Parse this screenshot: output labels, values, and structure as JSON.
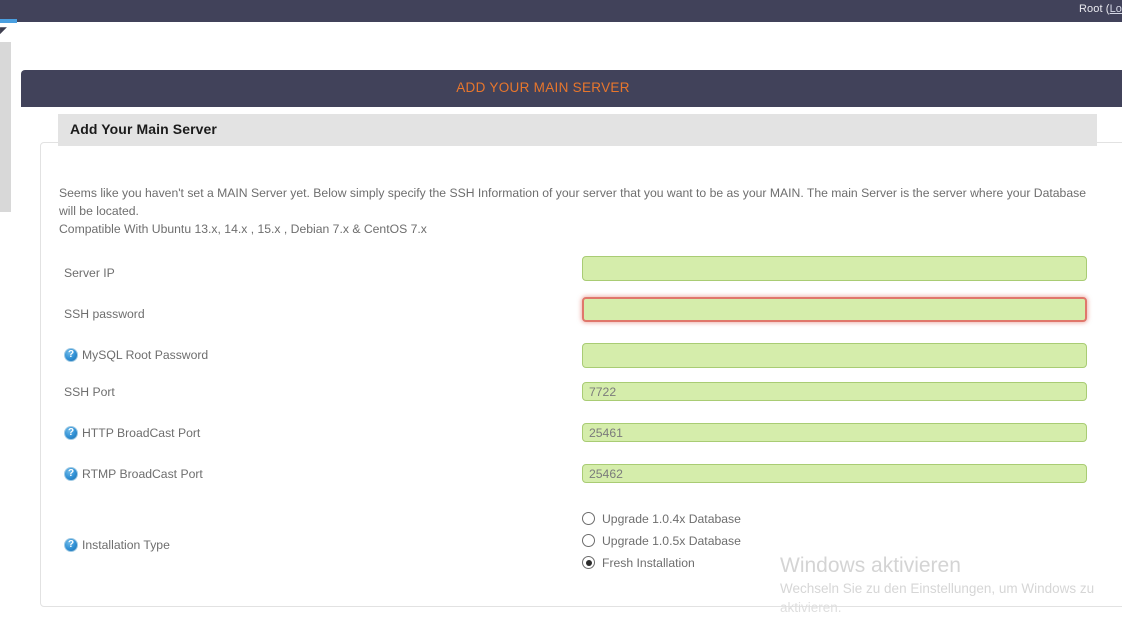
{
  "topbar": {
    "user_prefix": "Root (",
    "user_link": "Lo"
  },
  "left_gutter": {
    "glyph": "◤"
  },
  "banner": {
    "title": "ADD YOUR MAIN SERVER"
  },
  "section": {
    "heading": "Add Your Main Server"
  },
  "intro": {
    "paragraph": "Seems like you haven't set a MAIN Server yet. Below simply specify the SSH Information of your server that you want to be as your MAIN. The main Server is the server where your Database will be located.",
    "compatible": "Compatible With Ubuntu 13.x, 14.x , 15.x , Debian 7.x & CentOS 7.x"
  },
  "form": {
    "fields": [
      {
        "label": "Server IP",
        "value": "",
        "placeholder": "",
        "has_help_icon": false,
        "size": "tall",
        "state": "normal"
      },
      {
        "label": "SSH password",
        "value": "",
        "placeholder": "",
        "has_help_icon": false,
        "size": "tall",
        "state": "error"
      },
      {
        "label": "MySQL Root Password",
        "value": "",
        "placeholder": "",
        "has_help_icon": true,
        "size": "tall",
        "state": "normal"
      },
      {
        "label": "SSH Port",
        "value": "7722",
        "placeholder": "",
        "has_help_icon": false,
        "size": "short",
        "state": "normal"
      },
      {
        "label": "HTTP BroadCast Port",
        "value": "25461",
        "placeholder": "",
        "has_help_icon": true,
        "size": "short",
        "state": "normal"
      },
      {
        "label": "RTMP BroadCast Port",
        "value": "25462",
        "placeholder": "",
        "has_help_icon": true,
        "size": "short",
        "state": "normal"
      }
    ],
    "installation_type": {
      "label": "Installation Type",
      "has_help_icon": true,
      "options": [
        {
          "label": "Upgrade 1.0.4x Database",
          "selected": false
        },
        {
          "label": "Upgrade 1.0.5x Database",
          "selected": false
        },
        {
          "label": "Fresh Installation",
          "selected": true
        }
      ]
    }
  },
  "watermark": {
    "title": "Windows aktivieren",
    "line1": "Wechseln Sie zu den Einstellungen, um Windows zu",
    "line2": "aktivieren."
  },
  "colors": {
    "header_dark": "#41425a",
    "banner_title": "#e8762c",
    "input_fill": "#d5edab",
    "input_border": "#a9cc74",
    "error_border": "#e0776b",
    "accent_blue": "#4a9fe0"
  }
}
